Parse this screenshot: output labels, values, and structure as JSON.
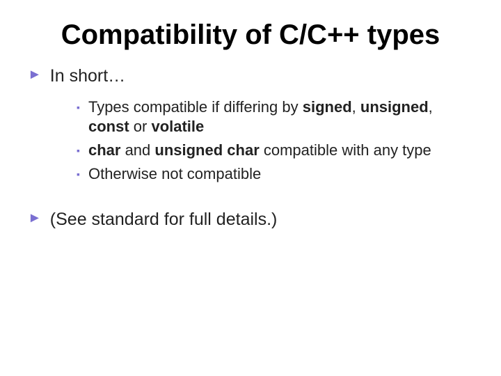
{
  "title": "Compatibility of C/C++ types",
  "l1": {
    "items": [
      {
        "text": "In short…"
      },
      {
        "text": "(See standard for full details.)"
      }
    ]
  },
  "l2": {
    "items": [
      {
        "pre": "Types compatible if differing by ",
        "k1": "signed",
        "sep1": ", ",
        "k2": "unsigned",
        "sep2": ", ",
        "k3": "const",
        "sep3": " or ",
        "k4": "volatile"
      },
      {
        "k1": "char",
        "mid": " and ",
        "k2": "unsigned char",
        "post": " compatible with any type"
      },
      {
        "text": "Otherwise not compatible"
      }
    ]
  },
  "glyphs": {
    "tri": "►",
    "sq": "▪"
  }
}
